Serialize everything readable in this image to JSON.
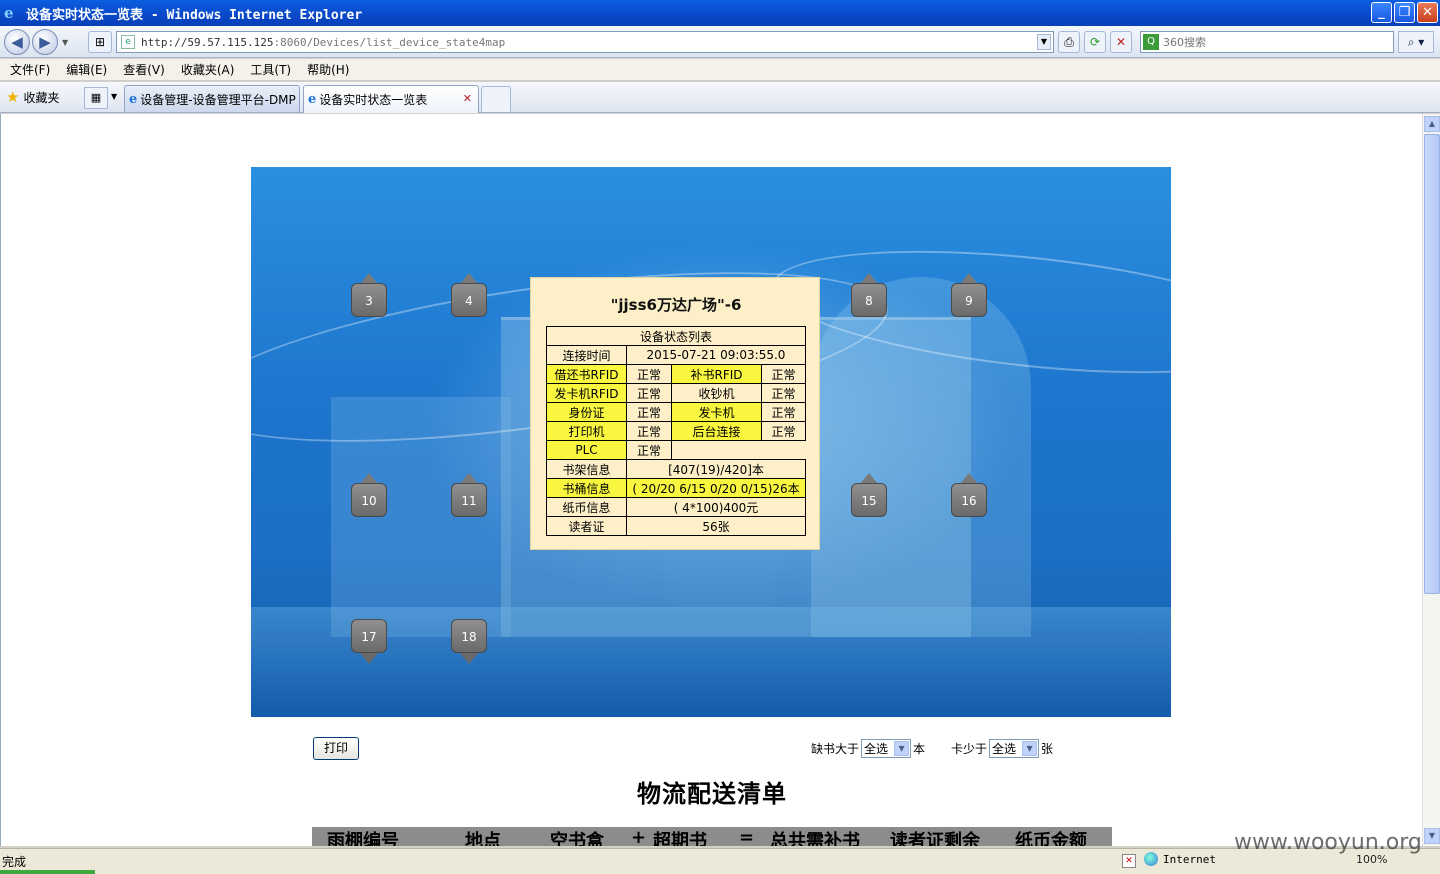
{
  "window": {
    "title": "设备实时状态一览表 - Windows Internet Explorer"
  },
  "address": {
    "url_host": "http://59.57.115.125",
    "url_path": ":8060/Devices/list_device_state4map"
  },
  "search": {
    "placeholder": "360搜索"
  },
  "menu": [
    "文件(F)",
    "编辑(E)",
    "查看(V)",
    "收藏夹(A)",
    "工具(T)",
    "帮助(H)"
  ],
  "favorites_label": "收藏夹",
  "tabs": [
    {
      "label": "设备管理-设备管理平台-DMP",
      "active": false
    },
    {
      "label": "设备实时状态一览表",
      "active": true
    }
  ],
  "markers": [
    "3",
    "4",
    "8",
    "9",
    "10",
    "11",
    "15",
    "16",
    "17",
    "18"
  ],
  "popup": {
    "title": "\"jjss6万达广场\"-6",
    "table_header": "设备状态列表",
    "connect_label": "连接时间",
    "connect_time": "2015-07-21 09:03:55.0",
    "status_rows": [
      [
        "借还书RFID",
        "正常",
        "补书RFID",
        "正常"
      ],
      [
        "发卡机RFID",
        "正常",
        "收钞机",
        "正常"
      ],
      [
        "身份证",
        "正常",
        "发卡机",
        "正常"
      ],
      [
        "打印机",
        "正常",
        "后台连接",
        "正常"
      ]
    ],
    "plc_label": "PLC",
    "plc_value": "正常",
    "info_rows": [
      [
        "书架信息",
        "[407(19)/420]本"
      ],
      [
        "书桶信息",
        "( 20/20 6/15 0/20 0/15)26本"
      ],
      [
        "纸币信息",
        "( 4*100)400元"
      ],
      [
        "读者证",
        "56张"
      ]
    ]
  },
  "controls": {
    "print_label": "打印",
    "books_prefix": "缺书大于",
    "books_value": "全选",
    "books_suffix": "本",
    "cards_prefix": "卡少于",
    "cards_value": "全选",
    "cards_suffix": "张"
  },
  "list": {
    "title": "物流配送清单",
    "headers": [
      "雨棚编号",
      "地点",
      "空书盒",
      "+",
      "超期书",
      "=",
      "总共需补书",
      "读者证剩余",
      "纸币金额"
    ]
  },
  "status": {
    "text": "完成",
    "zone": "Internet",
    "zoom": "100%"
  },
  "watermark": "www.wooyun.org"
}
